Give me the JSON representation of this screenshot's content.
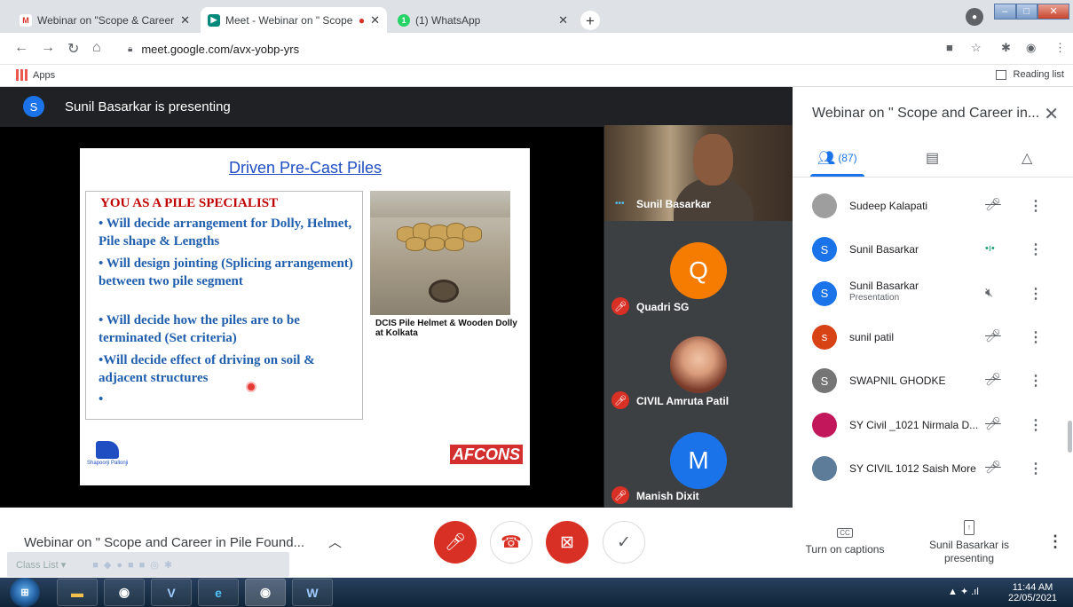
{
  "browser": {
    "tabs": [
      {
        "title": "Webinar on \"Scope & Career in P",
        "fav_color": "#ffffff",
        "fav_text": "M",
        "fav_fg": "#d93025"
      },
      {
        "title": "Meet - Webinar on \" Scope a",
        "fav_color": "#00897b",
        "fav_text": "▶",
        "fav_fg": "#ffffff",
        "recording": "●"
      },
      {
        "title": "(1) WhatsApp",
        "fav_color": "#25d366",
        "fav_text": "1",
        "fav_fg": "#ffffff"
      }
    ],
    "new_tab": "+",
    "url": "meet.google.com/avx-yobp-yrs",
    "bookmarks": {
      "apps": "Apps",
      "reading_list": "Reading list"
    }
  },
  "meet": {
    "presenting_banner": "Sunil Basarkar is presenting",
    "presenter_initial": "S",
    "slide": {
      "title": "Driven Pre-Cast Piles",
      "heading": "YOU AS A PILE SPECIALIST",
      "bullets": [
        "• Will decide arrangement for Dolly, Helmet, Pile shape & Lengths",
        "• Will design jointing (Splicing arrangement) between two pile segment",
        "• Will decide how the piles are to be terminated (Set criteria)",
        "•Will decide effect of driving on soil & adjacent structures",
        "•"
      ],
      "photo_caption": "DCIS Pile Helmet & Wooden Dolly at Kolkata",
      "logo_left": "Shapoorji Pallonji",
      "logo_right": "AFCONS"
    },
    "tiles": [
      {
        "name": "Sunil Basarkar",
        "kind": "video"
      },
      {
        "name": "Quadri SG",
        "initial": "Q",
        "color": "#f57c00"
      },
      {
        "name": "CIVIL Amruta Patil",
        "kind": "photo"
      },
      {
        "name": "Manish Dixit",
        "initial": "M",
        "color": "#1a73e8"
      }
    ],
    "panel": {
      "title": "Webinar on \" Scope and Career in...",
      "people_count": "(87)",
      "participants": [
        {
          "name": "Sudeep Kalapati",
          "initial": "",
          "color": "#9e9e9e",
          "mic": "muted"
        },
        {
          "name": "Sunil Basarkar",
          "initial": "S",
          "color": "#1a73e8",
          "mic": "speaking"
        },
        {
          "name": "Sunil Basarkar",
          "sub": "Presentation",
          "initial": "S",
          "color": "#1a73e8",
          "mic": "presentation"
        },
        {
          "name": "sunil patil",
          "initial": "s",
          "color": "#d84315",
          "mic": "muted"
        },
        {
          "name": "SWAPNIL GHODKE",
          "initial": "S",
          "color": "#757575",
          "mic": "muted"
        },
        {
          "name": "SY Civil _1021 Nirmala D...",
          "initial": "",
          "color": "#c2185b",
          "mic": "muted"
        },
        {
          "name": "SY CIVIL 1012 Saish More",
          "initial": "",
          "color": "#5c7c9a",
          "mic": "muted"
        }
      ]
    },
    "bottom": {
      "meeting_title": "Webinar on \" Scope and Career in Pile Found...",
      "captions_label": "Turn on captions",
      "present_label": "Sunil Basarkar is presenting"
    }
  },
  "overlay": {
    "class_list": "Class List ▾"
  },
  "taskbar": {
    "time": "11:44 AM",
    "date": "22/05/2021"
  }
}
